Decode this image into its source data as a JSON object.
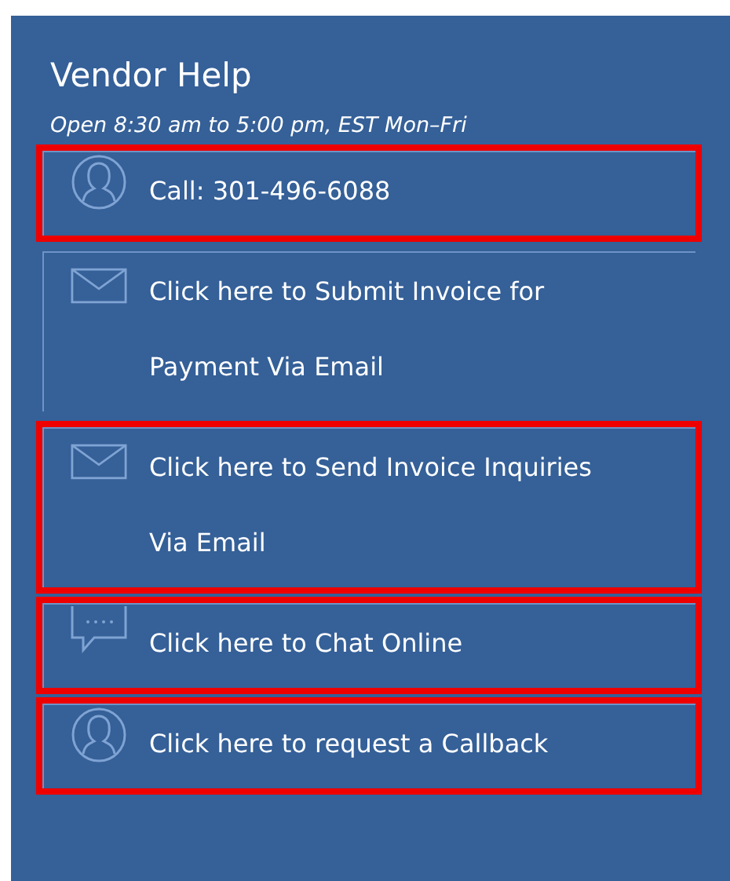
{
  "title": "Vendor Help",
  "hours": "Open 8:30 am to 5:00 pm, EST Mon–Fri",
  "items": [
    {
      "kind": "person",
      "label": "Call: 301-496-6088",
      "highlighted": true
    },
    {
      "kind": "envelope",
      "label": "Click here to Submit Invoice for Payment Via Email",
      "highlighted": false
    },
    {
      "kind": "envelope",
      "label": "Click here to Send Invoice Inquiries Via Email",
      "highlighted": true
    },
    {
      "kind": "chat",
      "label": "Click here to Chat Online",
      "highlighted": true
    },
    {
      "kind": "person",
      "label": "Click here to request a Callback",
      "highlighted": true
    }
  ]
}
